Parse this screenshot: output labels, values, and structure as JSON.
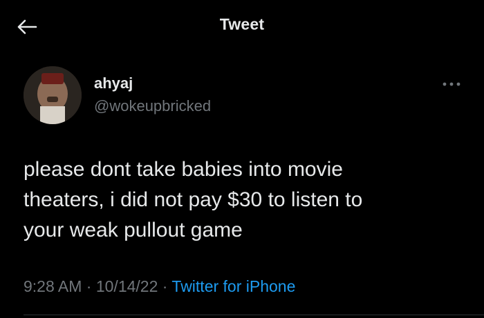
{
  "header": {
    "title": "Tweet",
    "back_icon": "arrow-left-icon"
  },
  "tweet": {
    "author": {
      "name": "ahyaj",
      "handle": "@wokeupbricked",
      "avatar_icon": "user-avatar"
    },
    "more_icon": "more-horizontal-icon",
    "text": "please dont take babies into movie\ntheaters, i did not pay $30 to listen to\nyour weak pullout game",
    "time": "9:28 AM",
    "separator": "·",
    "date": "10/14/22",
    "source": "Twitter for iPhone"
  },
  "colors": {
    "background": "#000000",
    "primary_text": "#e7e9ea",
    "secondary_text": "#71767b",
    "accent": "#1d9bf0",
    "divider": "#2f3336"
  }
}
